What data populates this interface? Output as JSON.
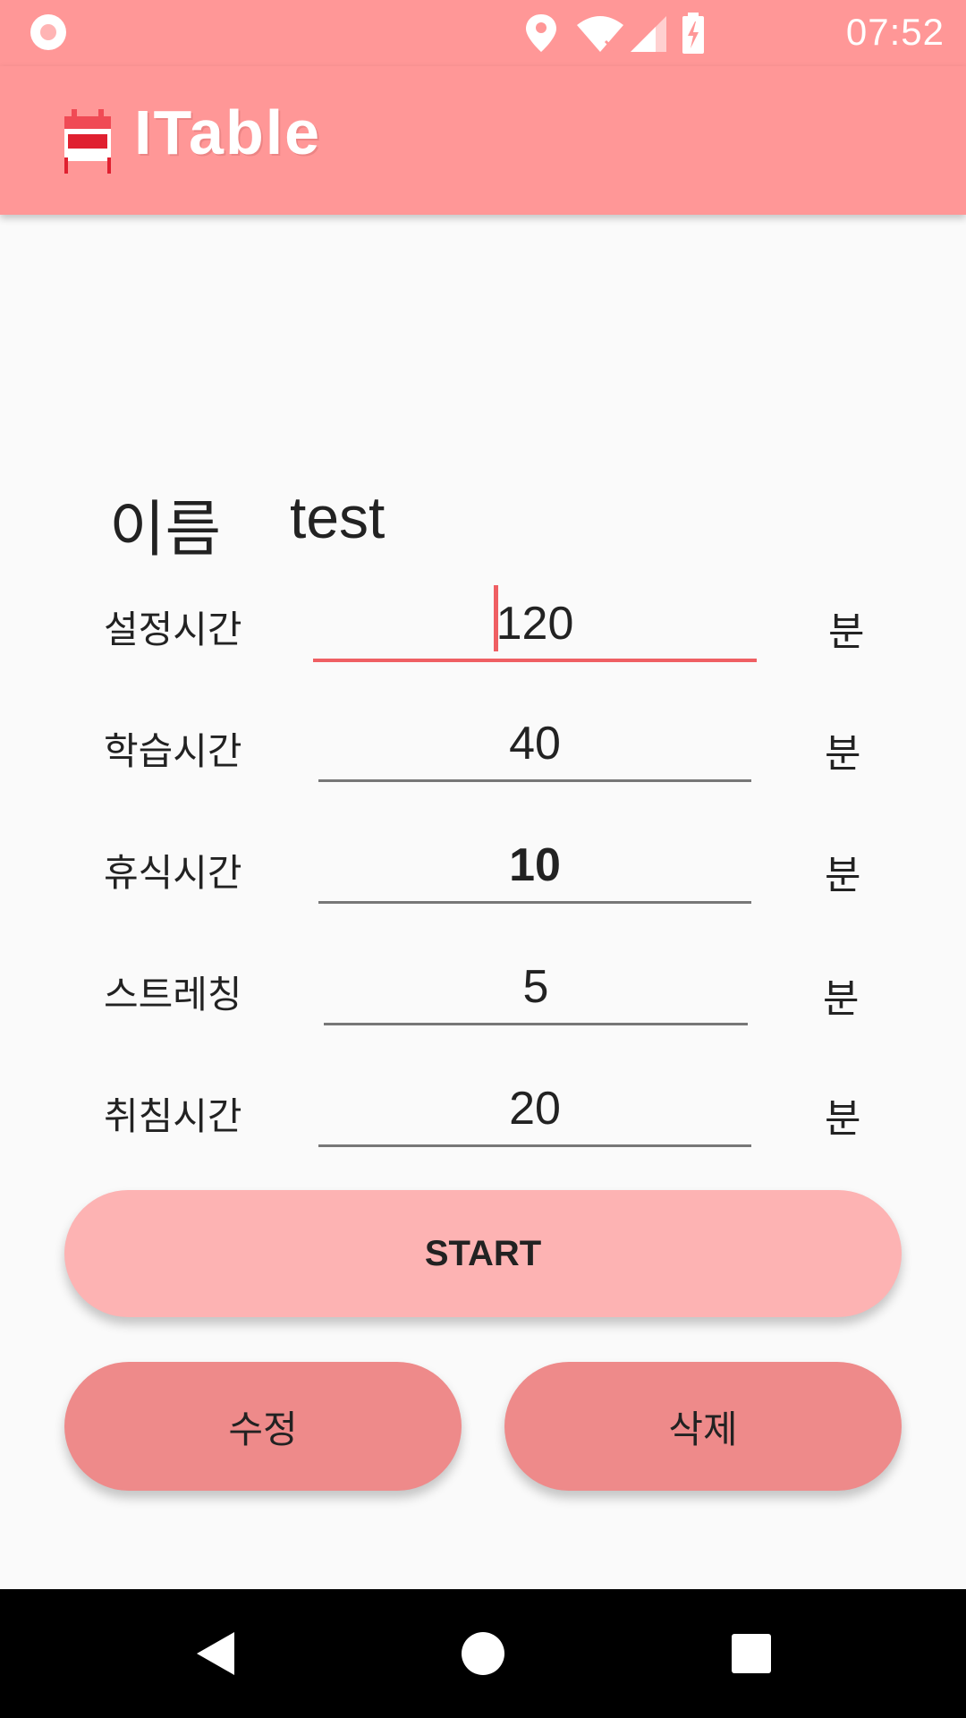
{
  "status_bar": {
    "time": "07:52",
    "icons": [
      "notification-circle-icon",
      "location-icon",
      "wifi-icon",
      "signal-icon",
      "battery-charging-icon"
    ]
  },
  "app_bar": {
    "title": "ITable",
    "icon": "calendar-icon"
  },
  "form": {
    "name_label": "이름",
    "name_value": "test",
    "rows": [
      {
        "label": "설정시간",
        "value": "120",
        "unit": "분"
      },
      {
        "label": "학습시간",
        "value": "40",
        "unit": "분"
      },
      {
        "label": "휴식시간",
        "value": "10",
        "unit": "분"
      },
      {
        "label": "스트레칭",
        "value": "5",
        "unit": "분"
      },
      {
        "label": "취침시간",
        "value": "20",
        "unit": "분"
      }
    ]
  },
  "buttons": {
    "start": "START",
    "edit": "수정",
    "delete": "삭제"
  },
  "nav_bar": {
    "icons": [
      "back-icon",
      "home-icon",
      "recents-icon"
    ]
  },
  "colors": {
    "primary": "#ff9797",
    "accent": "#ef5f63",
    "start_button": "#fdb3b3",
    "secondary_button": "#ee8a8a"
  }
}
